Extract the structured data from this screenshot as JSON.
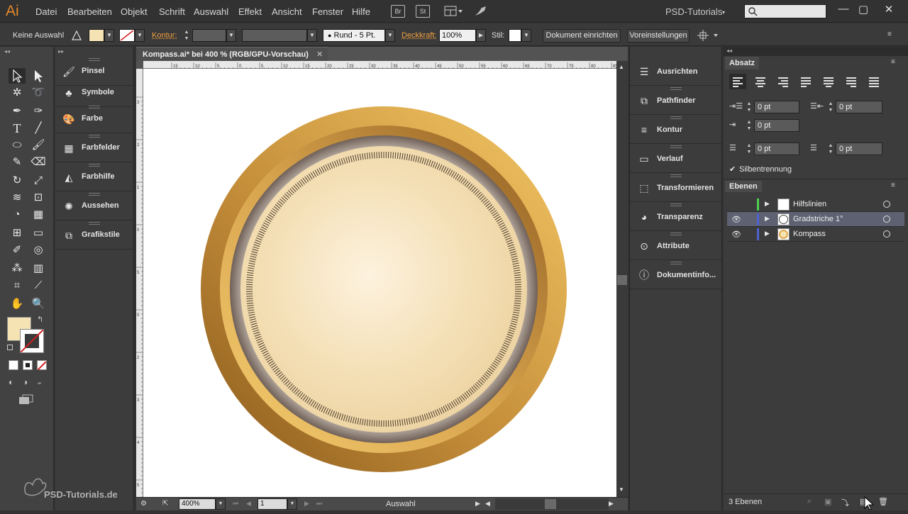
{
  "app": {
    "logo": "Ai",
    "menu": [
      "Datei",
      "Bearbeiten",
      "Objekt",
      "Schrift",
      "Auswahl",
      "Effekt",
      "Ansicht",
      "Fenster",
      "Hilfe"
    ],
    "bridge_btn": "Br",
    "stock_btn": "St",
    "workspace": "PSD-Tutorials",
    "window_controls": [
      "minimize-icon",
      "maximize-icon",
      "close-icon"
    ]
  },
  "controlbar": {
    "selection_state": "Keine Auswahl",
    "stroke_label": "Kontur:",
    "brush_label": "Rund - 5 Pt.",
    "opacity_label": "Deckkraft:",
    "opacity_value": "100%",
    "style_label": "Stil:",
    "doc_setup_btn": "Dokument einrichten",
    "preferences_btn": "Voreinstellungen",
    "fill_color": "#f6e3b4"
  },
  "panel_left": {
    "items": [
      {
        "label": "Pinsel",
        "icon": "brush-icon"
      },
      {
        "label": "Symbole",
        "icon": "symbols-icon"
      },
      {
        "label": "Farbe",
        "icon": "color-palette-icon"
      },
      {
        "label": "Farbfelder",
        "icon": "swatches-icon"
      },
      {
        "label": "Farbhilfe",
        "icon": "color-guide-icon"
      },
      {
        "label": "Aussehen",
        "icon": "appearance-icon"
      },
      {
        "label": "Grafikstile",
        "icon": "graphic-styles-icon"
      }
    ]
  },
  "document": {
    "tab_title": "Kompass.ai* bei 400 % (RGB/GPU-Vorschau)",
    "zoom": "400%",
    "artboard_number": "1",
    "status_tool": "Auswahl",
    "ruler_top_labels": [
      "15",
      "10",
      "5",
      "0",
      "5",
      "10",
      "15",
      "20",
      "25",
      "30",
      "35",
      "40",
      "45",
      "50",
      "55",
      "60",
      "65",
      "70",
      "75",
      "80",
      "85"
    ],
    "ruler_left_labels": [
      "3",
      "2",
      "1",
      "0",
      "5",
      "0",
      "2",
      "3",
      "4",
      "5"
    ]
  },
  "panel_right_collapsed": {
    "items": [
      {
        "label": "Ausrichten",
        "icon": "align-icon"
      },
      {
        "label": "Pathfinder",
        "icon": "pathfinder-icon"
      },
      {
        "label": "Kontur",
        "icon": "stroke-icon"
      },
      {
        "label": "Verlauf",
        "icon": "gradient-icon"
      },
      {
        "label": "Transformieren",
        "icon": "transform-icon"
      },
      {
        "label": "Transparenz",
        "icon": "transparency-icon"
      },
      {
        "label": "Attribute",
        "icon": "attributes-icon"
      },
      {
        "label": "Dokumentinfo...",
        "icon": "document-info-icon"
      }
    ]
  },
  "paragraph_panel": {
    "title": "Absatz",
    "indent_left": "0 pt",
    "indent_right": "0 pt",
    "first_line": "0 pt",
    "space_before": "0 pt",
    "space_after": "0 pt",
    "hyphenation_label": "Silbentrennung",
    "hyphenation_checked": true
  },
  "layers_panel": {
    "title": "Ebenen",
    "layers": [
      {
        "name": "Hilfslinien",
        "visible": false,
        "color": "#4fd04f",
        "selected": false
      },
      {
        "name": "Gradstriche 1°",
        "visible": true,
        "color": "#4f62d0",
        "selected": true
      },
      {
        "name": "Kompass",
        "visible": true,
        "color": "#4f62d0",
        "selected": false
      }
    ],
    "count_label": "3 Ebenen"
  },
  "watermark": "PSD-Tutorials.de"
}
